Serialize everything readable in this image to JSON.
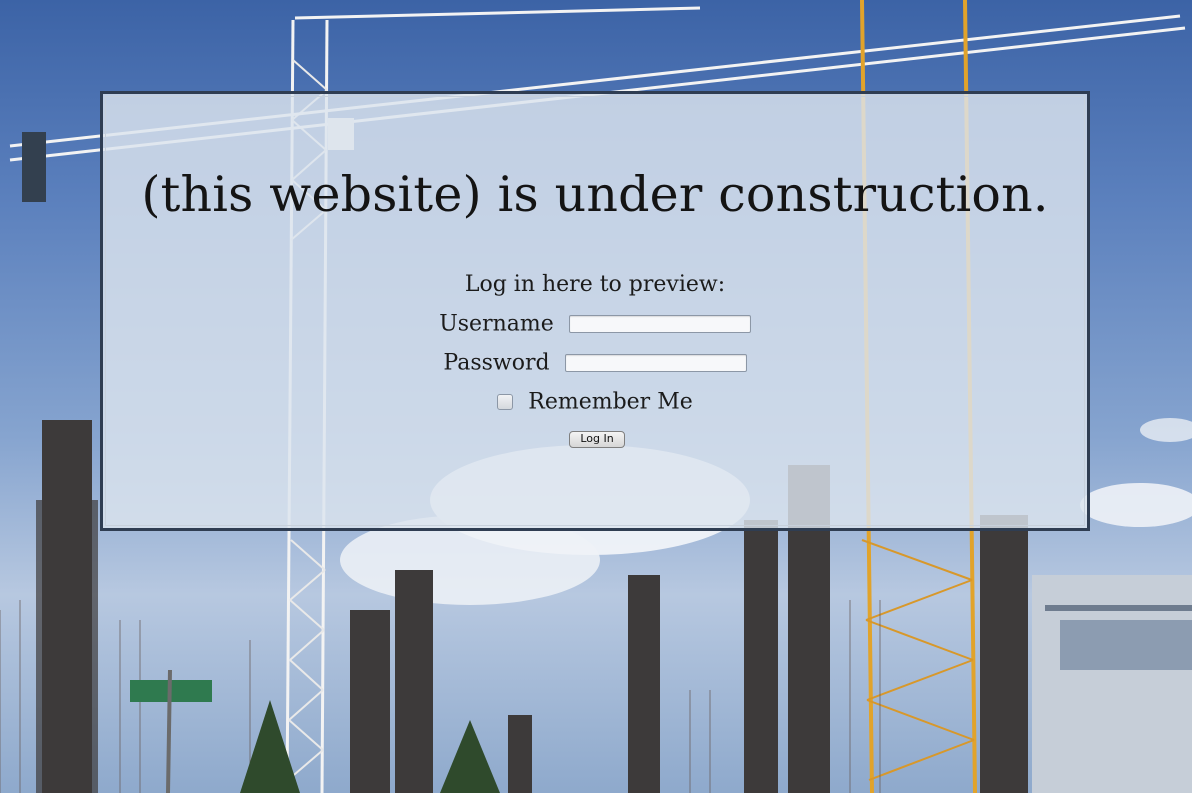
{
  "page": {
    "title": "(this website) is under construction."
  },
  "login": {
    "prompt": "Log in here to preview:",
    "username_label": "Username",
    "password_label": "Password",
    "remember_label": "Remember Me",
    "submit_label": "Log In",
    "username_value": "",
    "password_value": ""
  },
  "colors": {
    "panel_border": "#2f3d52",
    "panel_fill": "#dce4ee",
    "sky": "#5b80bd",
    "crane_white": "#f2f2f2",
    "crane_yellow": "#e1a32b"
  }
}
